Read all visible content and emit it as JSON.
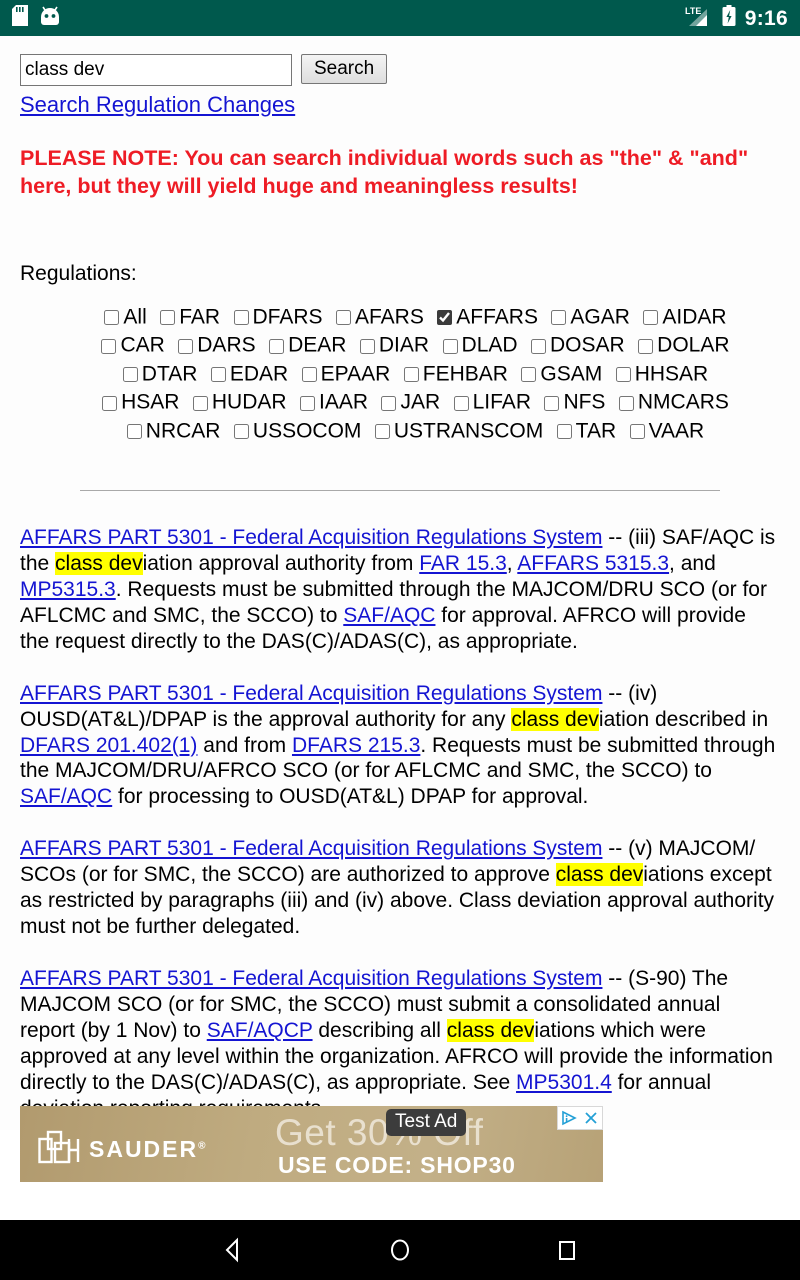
{
  "status_bar": {
    "background_color": "#00594d",
    "left_icons": [
      "sd-card-icon",
      "android-head-icon"
    ],
    "network_label": "LTE",
    "right_icons": [
      "lte-signal-icon",
      "battery-charging-icon"
    ],
    "clock": "9:16"
  },
  "search": {
    "input_value": "class dev",
    "input_placeholder": "",
    "button_label": "Search",
    "regulation_changes_link": "Search Regulation Changes"
  },
  "notice": {
    "text": "PLEASE NOTE: You can search individual words such as \"the\" & \"and\" here, but they will yield huge and meaningless results!",
    "color": "#ee1c25"
  },
  "regulations": {
    "label": "Regulations:",
    "checkboxes": [
      {
        "label": "All",
        "checked": false
      },
      {
        "label": "FAR",
        "checked": false
      },
      {
        "label": "DFARS",
        "checked": false
      },
      {
        "label": "AFARS",
        "checked": false
      },
      {
        "label": "AFFARS",
        "checked": true
      },
      {
        "label": "AGAR",
        "checked": false
      },
      {
        "label": "AIDAR",
        "checked": false
      },
      {
        "label": "CAR",
        "checked": false
      },
      {
        "label": "DARS",
        "checked": false
      },
      {
        "label": "DEAR",
        "checked": false
      },
      {
        "label": "DIAR",
        "checked": false
      },
      {
        "label": "DLAD",
        "checked": false
      },
      {
        "label": "DOSAR",
        "checked": false
      },
      {
        "label": "DOLAR",
        "checked": false
      },
      {
        "label": "DTAR",
        "checked": false
      },
      {
        "label": "EDAR",
        "checked": false
      },
      {
        "label": "EPAAR",
        "checked": false
      },
      {
        "label": "FEHBAR",
        "checked": false
      },
      {
        "label": "GSAM",
        "checked": false
      },
      {
        "label": "HHSAR",
        "checked": false
      },
      {
        "label": "HSAR",
        "checked": false
      },
      {
        "label": "HUDAR",
        "checked": false
      },
      {
        "label": "IAAR",
        "checked": false
      },
      {
        "label": "JAR",
        "checked": false
      },
      {
        "label": "LIFAR",
        "checked": false
      },
      {
        "label": "NFS",
        "checked": false
      },
      {
        "label": "NMCARS",
        "checked": false
      },
      {
        "label": "NRCAR",
        "checked": false
      },
      {
        "label": "USSOCOM",
        "checked": false
      },
      {
        "label": "USTRANSCOM",
        "checked": false
      },
      {
        "label": "TAR",
        "checked": false
      },
      {
        "label": "VAAR",
        "checked": false
      }
    ]
  },
  "results": {
    "highlight_color": "#ffff00",
    "link_color": "#1414d2",
    "items": [
      {
        "title": "AFFARS PART 5301 - Federal Acquisition Regulations System",
        "parts": [
          {
            "t": "text",
            "v": " -- (iii) SAF/AQC is the "
          },
          {
            "t": "highlight",
            "v": "class dev"
          },
          {
            "t": "text",
            "v": "iation approval authority from "
          },
          {
            "t": "link",
            "v": "FAR 15.3"
          },
          {
            "t": "text",
            "v": ", "
          },
          {
            "t": "link",
            "v": "AFFARS 5315.3"
          },
          {
            "t": "text",
            "v": ", and "
          },
          {
            "t": "link",
            "v": "MP5315.3"
          },
          {
            "t": "text",
            "v": ". Requests must be submitted through the MAJCOM/DRU SCO (or for AFLCMC and SMC, the SCCO) to "
          },
          {
            "t": "link",
            "v": "SAF/AQC"
          },
          {
            "t": "text",
            "v": " for approval. AFRCO will provide the request directly to the DAS(C)/ADAS(C), as appropriate."
          }
        ]
      },
      {
        "title": "AFFARS PART 5301 - Federal Acquisition Regulations System",
        "parts": [
          {
            "t": "text",
            "v": " -- (iv) OUSD(AT&L)/DPAP is the approval authority for any "
          },
          {
            "t": "highlight",
            "v": "class dev"
          },
          {
            "t": "text",
            "v": "iation described in "
          },
          {
            "t": "link",
            "v": "DFARS 201.402(1)"
          },
          {
            "t": "text",
            "v": " and from "
          },
          {
            "t": "link",
            "v": "DFARS 215.3"
          },
          {
            "t": "text",
            "v": ". Requests must be submitted through the MAJCOM/DRU/AFRCO SCO (or for AFLCMC and SMC, the SCCO) to "
          },
          {
            "t": "link",
            "v": "SAF/AQC"
          },
          {
            "t": "text",
            "v": " for processing to OUSD(AT&L) DPAP for approval."
          }
        ]
      },
      {
        "title": "AFFARS PART 5301 - Federal Acquisition Regulations System",
        "parts": [
          {
            "t": "text",
            "v": " -- (v) MAJCOM/ SCOs (or for SMC, the SCCO) are authorized to approve "
          },
          {
            "t": "highlight",
            "v": "class dev"
          },
          {
            "t": "text",
            "v": "iations except as restricted by paragraphs (iii) and (iv) above. Class deviation approval authority must not be further delegated."
          }
        ]
      },
      {
        "title": "AFFARS PART 5301 - Federal Acquisition Regulations System",
        "parts": [
          {
            "t": "text",
            "v": " -- (S-90) The MAJCOM SCO (or for SMC, the SCCO) must submit a consolidated annual report (by 1 Nov) to "
          },
          {
            "t": "link",
            "v": "SAF/AQCP"
          },
          {
            "t": "text",
            "v": " describing all "
          },
          {
            "t": "highlight",
            "v": "class dev"
          },
          {
            "t": "text",
            "v": "iations which were approved at any level within the organization. AFRCO will provide the information directly to the DAS(C)/ADAS(C), as appropriate. See "
          },
          {
            "t": "link",
            "v": "MP5301.4"
          },
          {
            "t": "text",
            "v": " for annual deviation reporting requirements."
          }
        ]
      }
    ]
  },
  "ad": {
    "brand": "SAUDER",
    "headline": "Get 30% Off",
    "subline": "USE CODE: SHOP30",
    "test_badge": "Test Ad",
    "background_color": "#bfab80",
    "controls": [
      "adchoices-icon",
      "close-icon"
    ]
  },
  "nav_bar": {
    "buttons": [
      "back-button",
      "home-button",
      "recents-button"
    ]
  }
}
